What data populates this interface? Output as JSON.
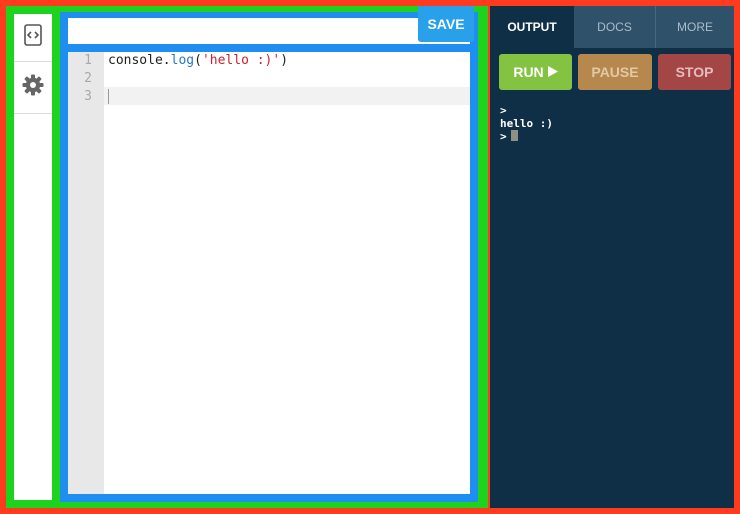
{
  "sidebar": {
    "items": [
      {
        "icon": "code-brackets-icon"
      },
      {
        "icon": "gear-icon"
      }
    ]
  },
  "editor": {
    "save_label": "SAVE",
    "line_numbers": [
      "1",
      "2",
      "3"
    ],
    "code": {
      "line1_prefix": "console.",
      "line1_method": "log",
      "line1_open": "(",
      "line1_string": "'hello :)'",
      "line1_close": ")"
    }
  },
  "output_panel": {
    "tabs": [
      {
        "label": "OUTPUT",
        "active": true
      },
      {
        "label": "DOCS",
        "active": false
      },
      {
        "label": "MORE",
        "active": false
      }
    ],
    "run_label": "RUN",
    "pause_label": "PAUSE",
    "stop_label": "STOP",
    "console_lines": [
      ">",
      "hello :)",
      ">"
    ]
  },
  "colors": {
    "frame_red": "#ff3b1f",
    "frame_green": "#1ed31e",
    "frame_blue": "#1f8ef1",
    "panel_bg": "#0e2f46",
    "run_green": "#84c341",
    "pause_orange": "#b7884d",
    "stop_red": "#a54646"
  }
}
